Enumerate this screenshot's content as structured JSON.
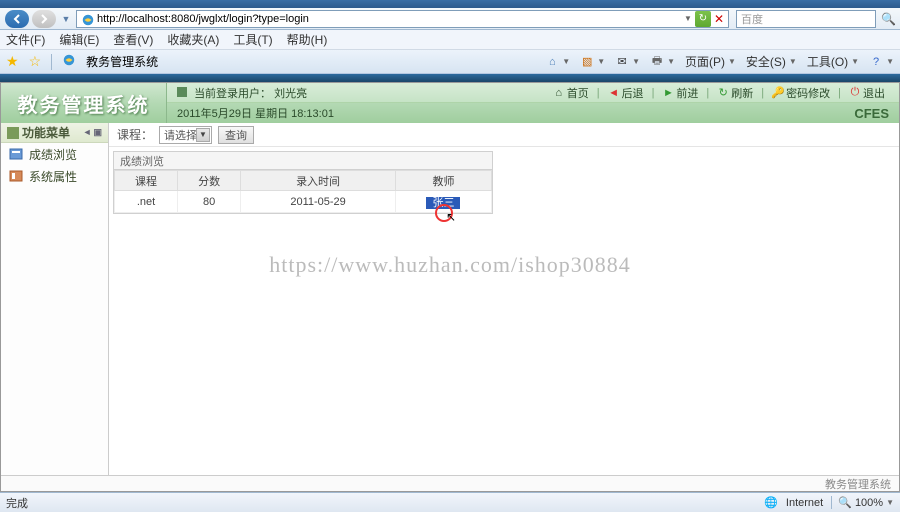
{
  "browser": {
    "url": "http://localhost:8080/jwglxt/login?type=login",
    "search_placeholder": "百度",
    "tab_title": "教务管理系统",
    "menu": {
      "file": "文件(F)",
      "edit": "编辑(E)",
      "view": "查看(V)",
      "favorites": "收藏夹(A)",
      "tools": "工具(T)",
      "help": "帮助(H)"
    },
    "fav_right": {
      "home": "",
      "page": "页面(P)",
      "safety": "安全(S)",
      "tool": "工具(O)"
    },
    "status_done": "完成",
    "status_zone": "Internet",
    "zoom": "100%"
  },
  "app": {
    "title": "教务管理系统",
    "user_label": "当前登录用户：",
    "user_name": "刘光亮",
    "date_text": "2011年5月29日 星期日 18:13:01",
    "cfes": "CFES",
    "actions": {
      "home": "首页",
      "back": "后退",
      "forward": "前进",
      "refresh": "刷新",
      "changepw": "密码修改",
      "logout": "退出"
    },
    "sidebar": {
      "menu_title": "功能菜单",
      "items": [
        "成绩浏览",
        "系统属性"
      ]
    },
    "filter": {
      "label": "课程：",
      "select_value": "请选择",
      "query": "查询"
    },
    "panel": {
      "title": "成绩浏览",
      "headers": [
        "课程",
        "分数",
        "录入时间",
        "教师"
      ],
      "row": {
        "course": ".net",
        "score": "80",
        "date": "2011-05-29",
        "teacher": "张三"
      }
    },
    "footer_text": "教务管理系统"
  },
  "watermark_text": "https://www.huzhan.com/ishop30884"
}
